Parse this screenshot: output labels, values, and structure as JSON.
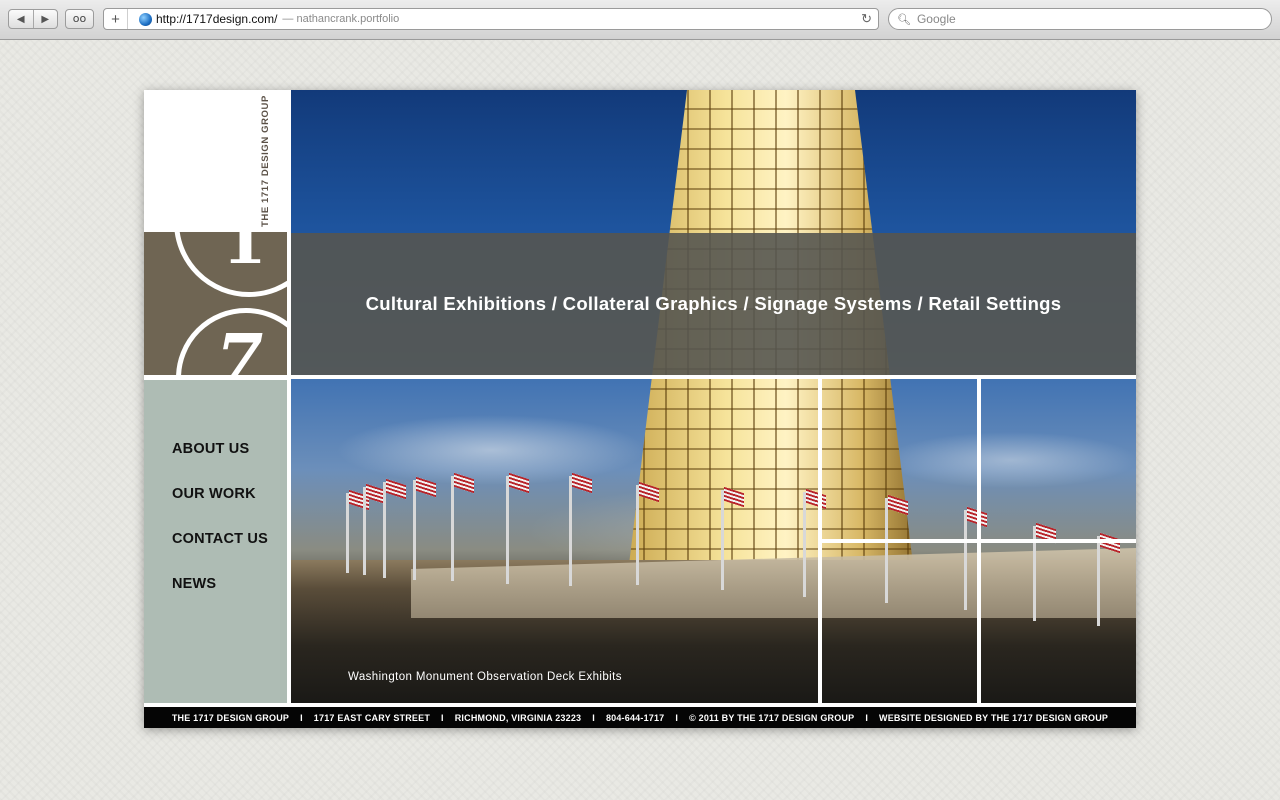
{
  "browser": {
    "url": "http://1717design.com/",
    "page_title": "— nathancrank.portfolio",
    "search_placeholder": "Google",
    "new_tab_glyph": "+",
    "back_glyph": "◀",
    "forward_glyph": "▶",
    "reader_glyph": "oo",
    "reload_glyph": "↻",
    "search_glyph": "🔍︎"
  },
  "brand": {
    "vertical_name": "THE 1717 DESIGN GROUP",
    "logo_digits": [
      "1",
      "7"
    ]
  },
  "nav": {
    "items": [
      {
        "label": "ABOUT US"
      },
      {
        "label": "OUR WORK"
      },
      {
        "label": "CONTACT US"
      },
      {
        "label": "NEWS"
      }
    ]
  },
  "hero": {
    "tagline": "Cultural Exhibitions / Collateral Graphics / Signage Systems / Retail Settings",
    "caption": "Washington Monument Observation Deck Exhibits"
  },
  "footer": {
    "items": [
      "THE 1717 DESIGN GROUP",
      "1717 EAST CARY STREET",
      "RICHMOND, VIRGINIA 23223",
      "804-644-1717",
      "© 2011 BY THE 1717 DESIGN GROUP",
      "WEBSITE DESIGNED BY THE 1717 DESIGN GROUP"
    ],
    "separator": "I"
  },
  "colors": {
    "logo_brown": "#6f6553",
    "nav_sage": "#aebcb4",
    "banner_gray": "#555550",
    "footer_black": "#050505"
  }
}
